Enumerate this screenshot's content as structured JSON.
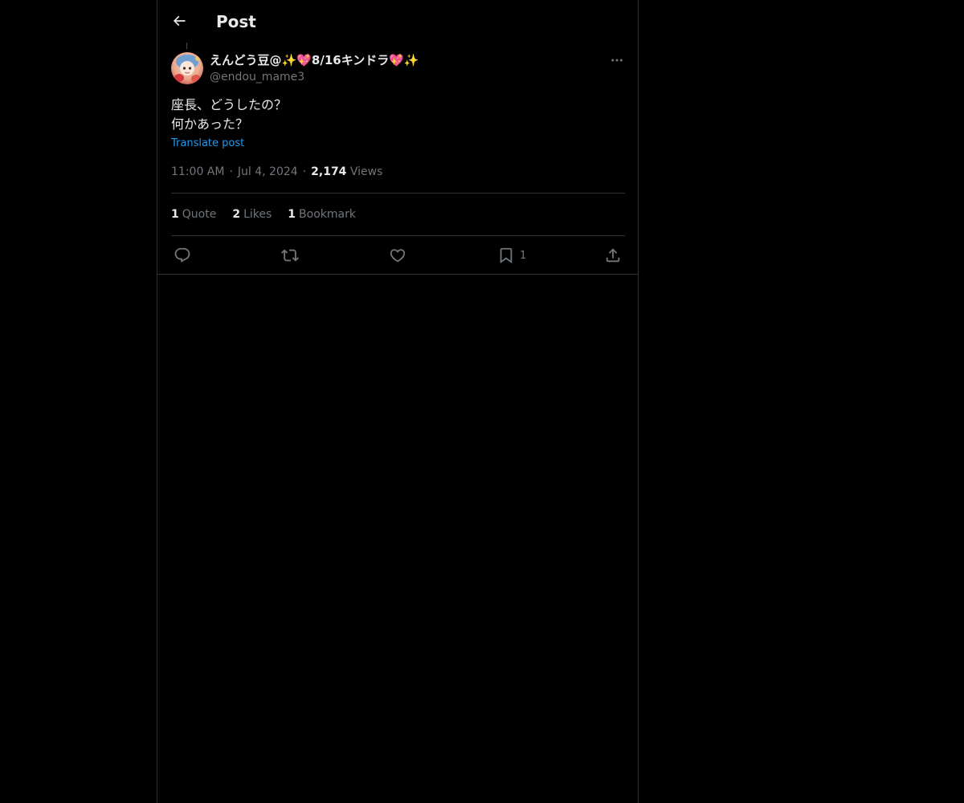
{
  "header": {
    "title": "Post",
    "back_icon": "arrow-left-icon"
  },
  "author": {
    "display_name": "えんどう豆@✨💖8/16キンドラ💖✨",
    "handle": "@endou_mame3",
    "avatar_icon": "user-avatar"
  },
  "post": {
    "text": "座長、どうしたの？\n何かあった？",
    "translate_label": "Translate post",
    "time": "11:00 AM",
    "date": "Jul 4, 2024",
    "views_count": "2,174",
    "views_label": "Views"
  },
  "stats": {
    "quotes_count": "1",
    "quotes_label": "Quote",
    "likes_count": "2",
    "likes_label": "Likes",
    "bookmarks_count": "1",
    "bookmarks_label": "Bookmark"
  },
  "actions": {
    "reply_icon": "reply-icon",
    "repost_icon": "repost-icon",
    "like_icon": "heart-icon",
    "bookmark_icon": "bookmark-icon",
    "bookmark_count": "1",
    "share_icon": "share-icon"
  },
  "colors": {
    "background": "#000000",
    "text_primary": "#e7e9ea",
    "text_secondary": "#71767b",
    "link": "#1d9bf0",
    "border": "#2f3336"
  }
}
